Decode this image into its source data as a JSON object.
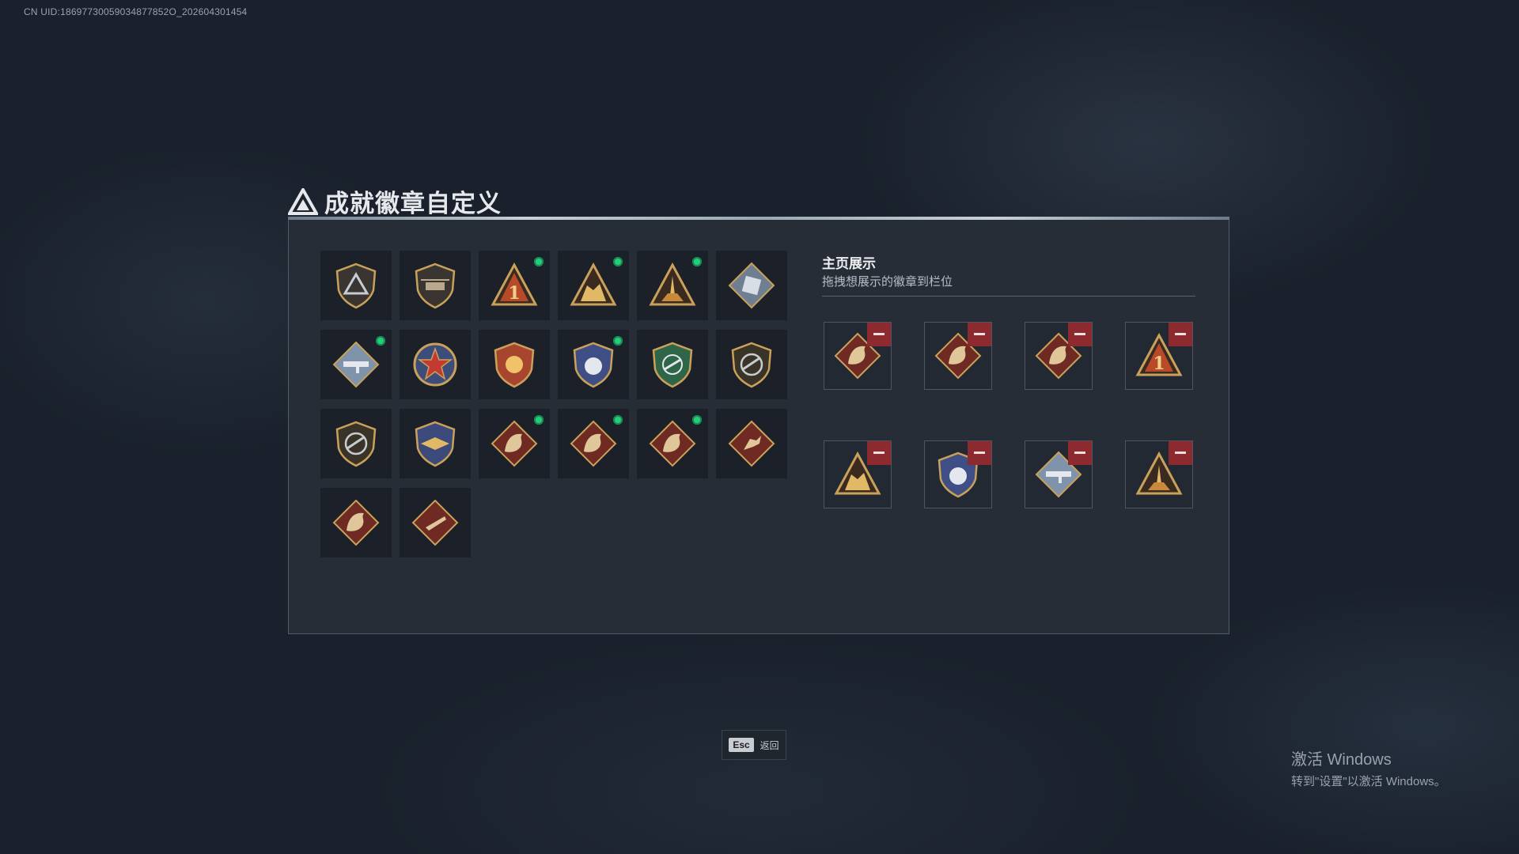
{
  "uid": "CN UID:18697730059034877852O_202604301454",
  "title": "成就徽章自定义",
  "colors": {
    "accent": "#22d07a",
    "remove": "#8d2a2f",
    "gold": "#c9a15a",
    "red_bg": "#6e2a23"
  },
  "badges": [
    {
      "icon": "triangle-emblem-icon",
      "new": false
    },
    {
      "icon": "helicopter-emblem-icon",
      "new": false
    },
    {
      "icon": "rank-one-triangle-icon",
      "new": true
    },
    {
      "icon": "soldiers-triangle-icon",
      "new": true
    },
    {
      "icon": "rocket-triangle-icon",
      "new": true
    },
    {
      "icon": "silver-crate-diamond-icon",
      "new": false
    },
    {
      "icon": "rocket-launcher-diamond-icon",
      "new": true
    },
    {
      "icon": "star-medal-icon",
      "new": false
    },
    {
      "icon": "crest-shield-icon",
      "new": false
    },
    {
      "icon": "blue-shield-icon",
      "new": true
    },
    {
      "icon": "green-crosshair-shield-icon",
      "new": false
    },
    {
      "icon": "rifle-shield-icon",
      "new": false
    },
    {
      "icon": "rifle-shield-alt-icon",
      "new": false
    },
    {
      "icon": "wings-shield-icon",
      "new": false
    },
    {
      "icon": "wolf-diamond-icon",
      "new": true
    },
    {
      "icon": "dragon-diamond-icon",
      "new": true
    },
    {
      "icon": "dragon-diamond-alt-icon",
      "new": true
    },
    {
      "icon": "runner-diamond-icon",
      "new": false
    },
    {
      "icon": "horse-diamond-icon",
      "new": false
    },
    {
      "icon": "weapon-diamond-icon",
      "new": false
    }
  ],
  "showcase": {
    "title": "主页展示",
    "subtitle": "拖拽想展示的徽章到栏位",
    "slots": [
      {
        "icon": "dragon-diamond-icon"
      },
      {
        "icon": "wolf-diamond-icon"
      },
      {
        "icon": "dragon-diamond-alt-icon"
      },
      {
        "icon": "rank-one-triangle-icon"
      },
      {
        "icon": "soldiers-triangle-icon"
      },
      {
        "icon": "blue-shield-icon"
      },
      {
        "icon": "rocket-launcher-diamond-icon"
      },
      {
        "icon": "rocket-triangle-icon"
      }
    ]
  },
  "footer": {
    "esc_key": "Esc",
    "esc_label": "返回"
  },
  "watermark": {
    "title": "激活 Windows",
    "subtitle": "转到\"设置\"以激活 Windows。"
  }
}
